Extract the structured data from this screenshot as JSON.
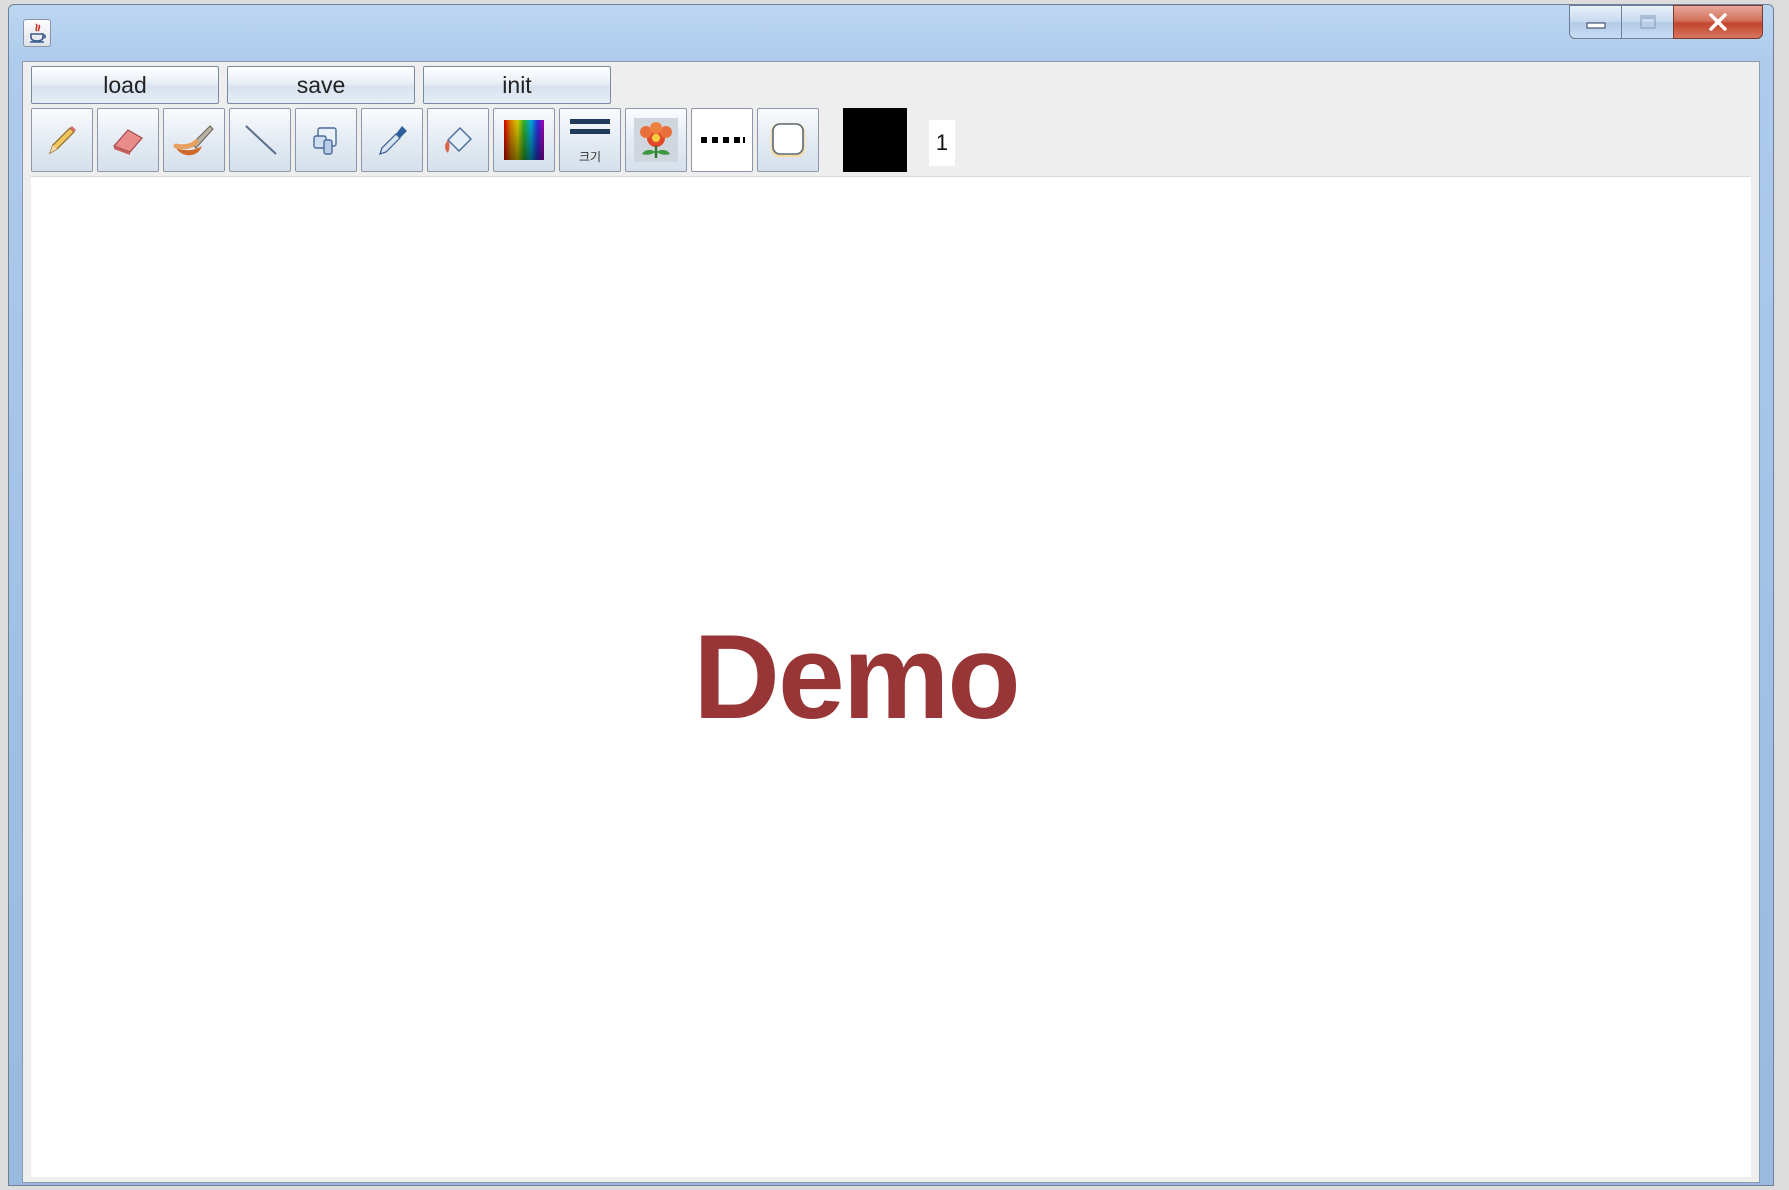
{
  "window": {
    "title": ""
  },
  "buttons": {
    "load": "load",
    "save": "save",
    "init": "init"
  },
  "toolbar": {
    "tools": [
      {
        "name": "pencil-icon"
      },
      {
        "name": "eraser-icon"
      },
      {
        "name": "brush-icon"
      },
      {
        "name": "line-icon"
      },
      {
        "name": "shapes-icon"
      },
      {
        "name": "eyedropper-icon"
      },
      {
        "name": "paint-bucket-icon"
      },
      {
        "name": "color-gradient-icon"
      },
      {
        "name": "line-thickness-icon",
        "label": "크기"
      },
      {
        "name": "flower-stamp-icon"
      },
      {
        "name": "dotted-line-icon"
      },
      {
        "name": "rounded-rect-icon"
      }
    ],
    "current_color": "#000000",
    "size_value": "1"
  },
  "canvas": {
    "text": "Demo",
    "text_color": "#983536"
  }
}
